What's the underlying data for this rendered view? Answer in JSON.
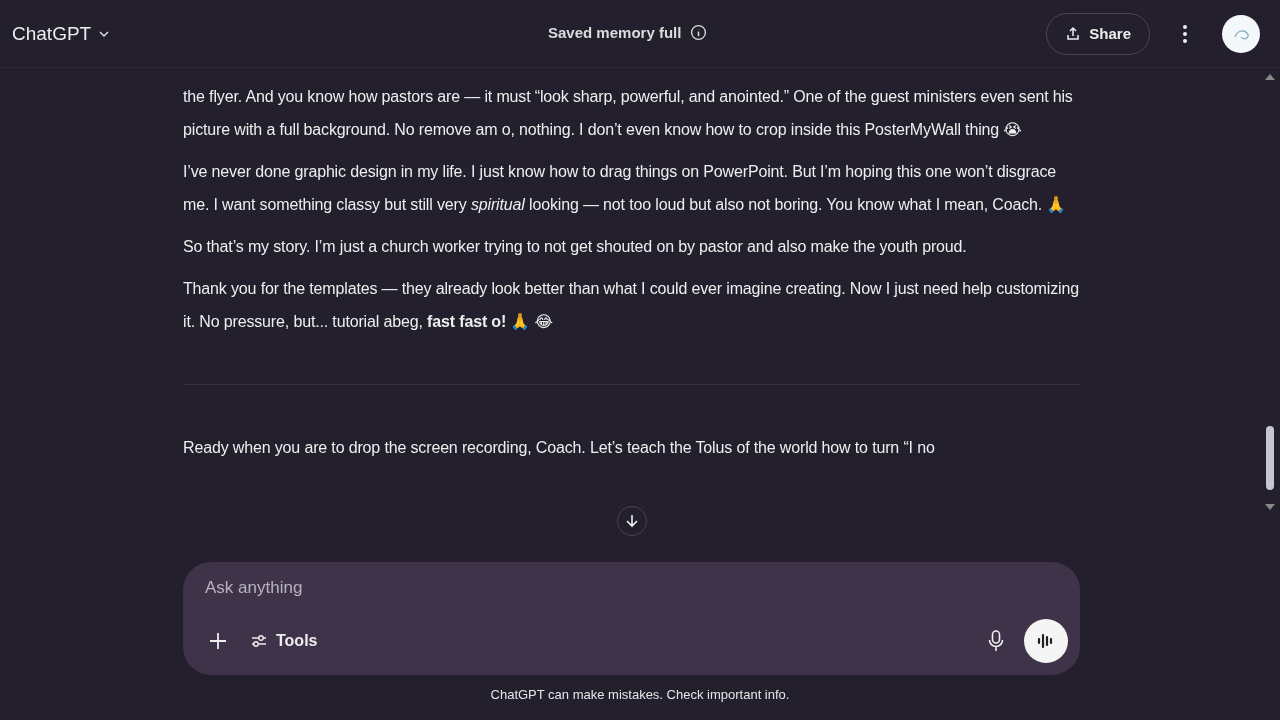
{
  "header": {
    "title": "ChatGPT",
    "notice": "Saved memory full",
    "share": "Share"
  },
  "messages": [
    {
      "kind": "user",
      "paragraphs": [
        "the flyer. And you know how pastors are — it must “look sharp, powerful, and anointed.” One of the guest ministers even sent his picture with a full background. No remove am o, nothing. I don’t even know how to crop inside this PosterMyWall thing 😭",
        "I’ve never done graphic design in my life. I just know how to drag things on PowerPoint. But I’m hoping this one won’t disgrace me. I want something classy but still very *spiritual* looking — not too loud but also not boring. You know what I mean, Coach. 🙏",
        "So that’s my story. I’m just a church worker trying to not get shouted on by pastor and also make the youth proud.",
        "Thank you for the templates — they already look better than what I could ever imagine creating. Now I just need help customizing it. No pressure, but... tutorial abeg, **fast fast o!** 🙏 😂"
      ]
    },
    {
      "kind": "assistant",
      "paragraphs": [
        "Ready when you are to drop the screen recording, Coach. Let’s teach the Tolus of the world how to turn “I no"
      ]
    }
  ],
  "composer": {
    "placeholder": "Ask anything",
    "tools": "Tools"
  },
  "disclaimer": "ChatGPT can make mistakes. Check important info."
}
